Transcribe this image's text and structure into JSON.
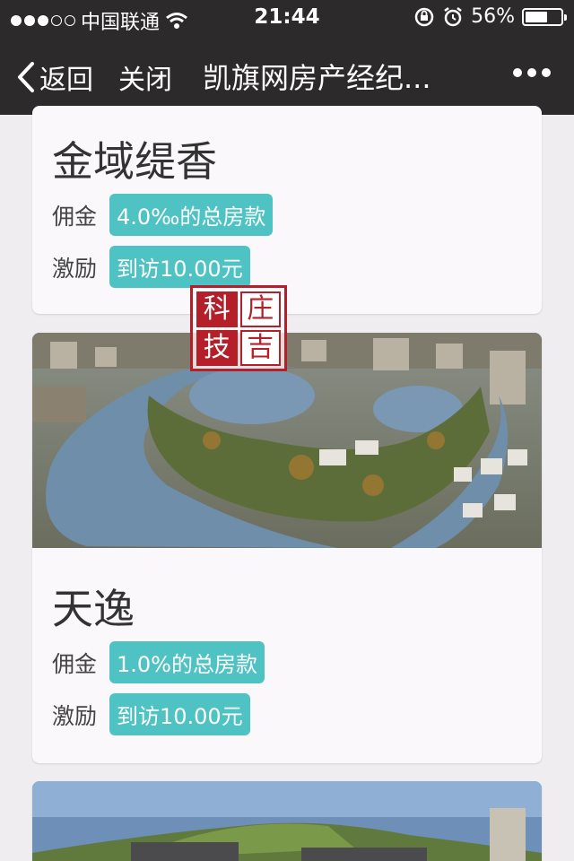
{
  "status": {
    "carrier": "中国联通",
    "time": "21:44",
    "battery": "56%",
    "signal_bars_filled": 3,
    "signal_bars_total": 5
  },
  "nav": {
    "back_label": "返回",
    "close_label": "关闭",
    "title": "凯旗网房产经纪..."
  },
  "stamp": {
    "chars": [
      "科",
      "庄",
      "技",
      "吉"
    ]
  },
  "listings": [
    {
      "name": "金域缇香",
      "commission_label": "佣金",
      "commission_value": "4.0‰的总房款",
      "incentive_label": "激励",
      "incentive_value": "到访10.00元"
    },
    {
      "name": "天逸",
      "commission_label": "佣金",
      "commission_value": "1.0%的总房款",
      "incentive_label": "激励",
      "incentive_value": "到访10.00元"
    }
  ],
  "colors": {
    "bar": "#2c2a2b",
    "tag": "#4fc3c4",
    "stamp": "#b41f2a"
  }
}
